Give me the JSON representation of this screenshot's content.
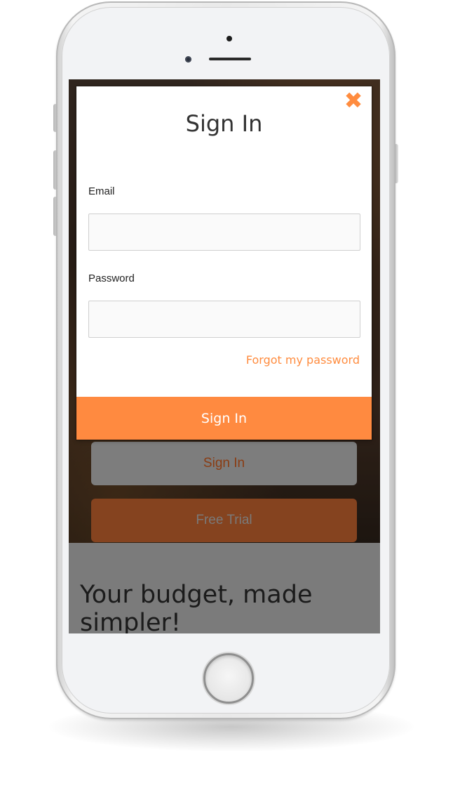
{
  "modal": {
    "title": "Sign In",
    "close_icon": "close-icon",
    "email_label": "Email",
    "email_value": "",
    "password_label": "Password",
    "password_value": "",
    "forgot_link": "Forgot my password",
    "submit_label": "Sign In"
  },
  "background": {
    "signin_label": "Sign In",
    "trial_label": "Free Trial",
    "tagline": "Your budget, made simpler!"
  },
  "colors": {
    "accent": "#ff8a40",
    "modal_bg": "#ffffff",
    "overlay": "#7b7b7b"
  }
}
